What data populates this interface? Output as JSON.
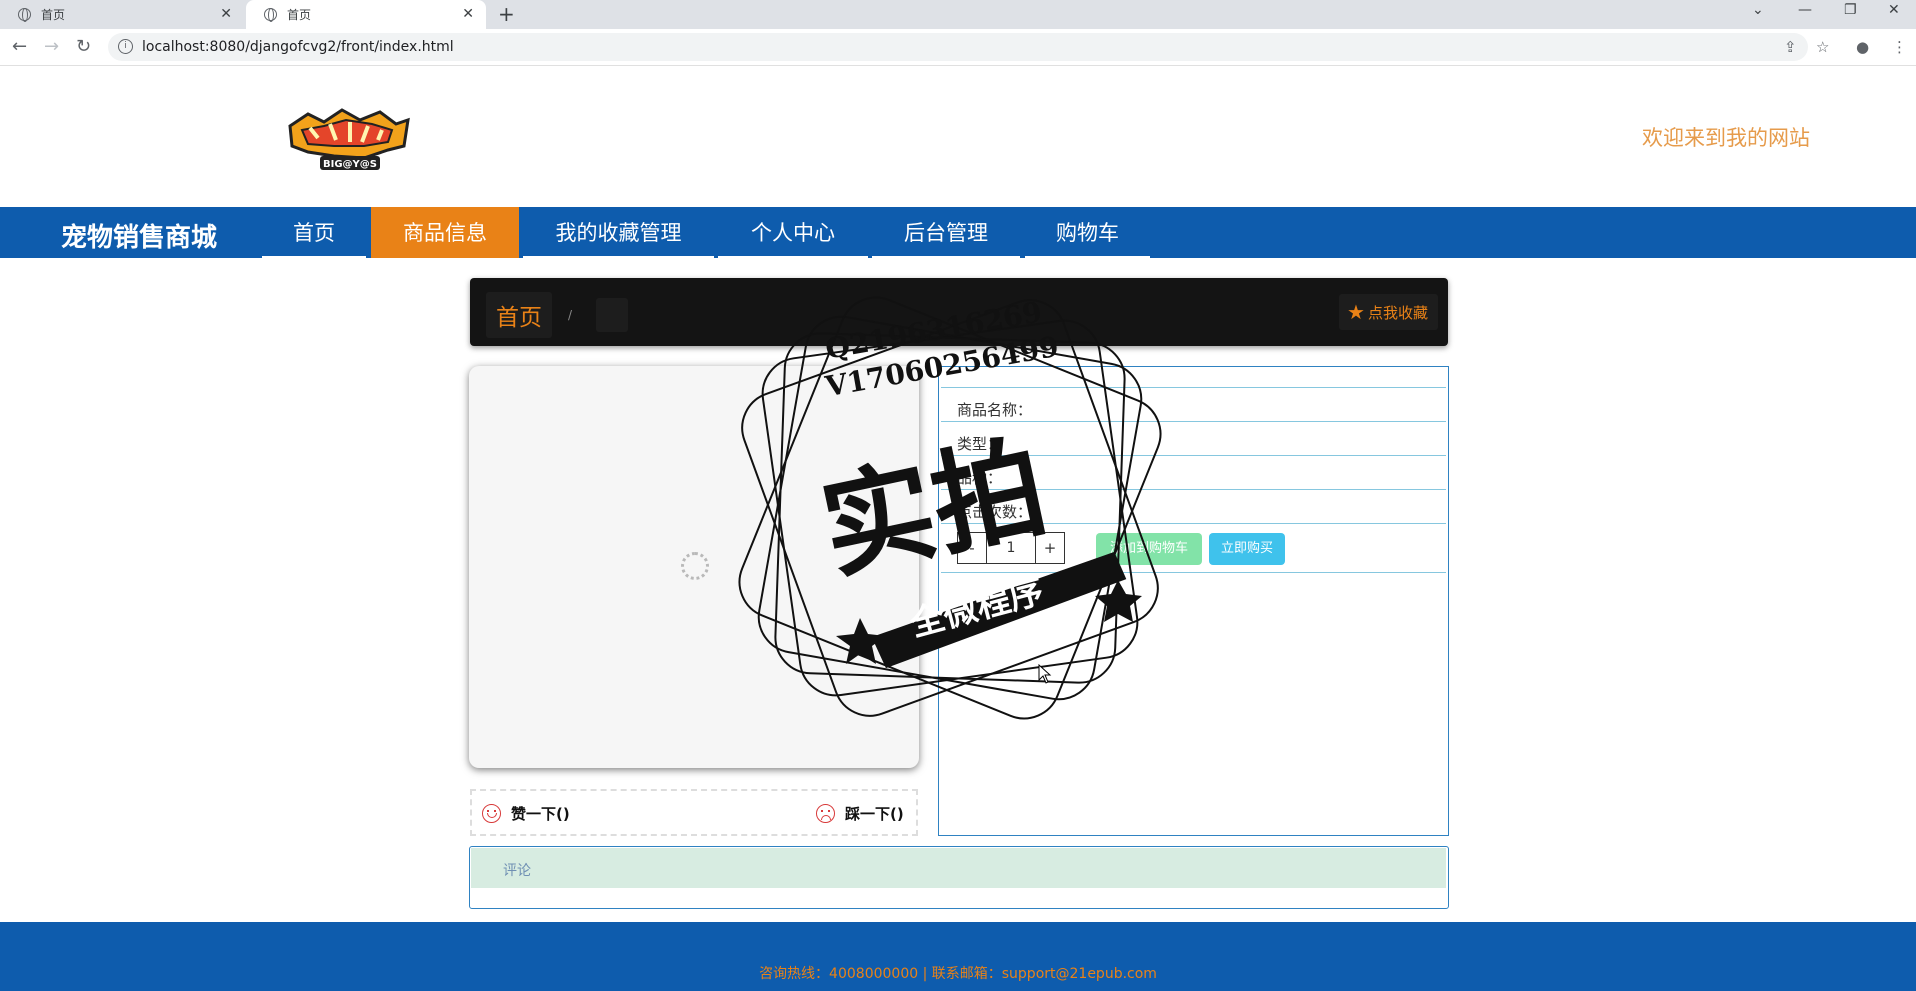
{
  "browser": {
    "tabs": [
      {
        "title": "首页"
      },
      {
        "title": "首页"
      }
    ],
    "url": "localhost:8080/djangofcvg2/front/index.html"
  },
  "site": {
    "welcome": "欢迎来到我的网站",
    "brand": "宠物销售商城",
    "logo_text": "BIG@Y@S",
    "nav": [
      {
        "label": "首页",
        "active": false
      },
      {
        "label": "商品信息",
        "active": true
      },
      {
        "label": "我的收藏管理",
        "active": false
      },
      {
        "label": "个人中心",
        "active": false
      },
      {
        "label": "后台管理",
        "active": false
      },
      {
        "label": "购物车",
        "active": false
      }
    ]
  },
  "breadcrumb": {
    "home": "首页",
    "separator": "/",
    "current": "",
    "favorite_label": "点我收藏"
  },
  "product": {
    "fields": [
      {
        "label": "商品名称："
      },
      {
        "label": "类型："
      },
      {
        "label": "品种："
      },
      {
        "label": "点击次数："
      }
    ],
    "quantity": "1",
    "minus": "-",
    "plus": "+",
    "add_to_cart": "添加到购物车",
    "buy_now": "立即购买"
  },
  "vote": {
    "like": "赞一下()",
    "dislike": "踩一下()"
  },
  "comments": {
    "title": "评论"
  },
  "footer": {
    "text": "咨询热线：4008000000 | 联系邮箱：support@21epub.com"
  },
  "watermark": {
    "line1": "Q2196316269",
    "line2": "V17060256499",
    "big": "实拍",
    "banner": "全微程序"
  },
  "colors": {
    "nav_bg": "#0e5cad",
    "accent": "#e98217",
    "cart_btn": "#82e3a8",
    "buy_btn": "#3fc2ec"
  }
}
